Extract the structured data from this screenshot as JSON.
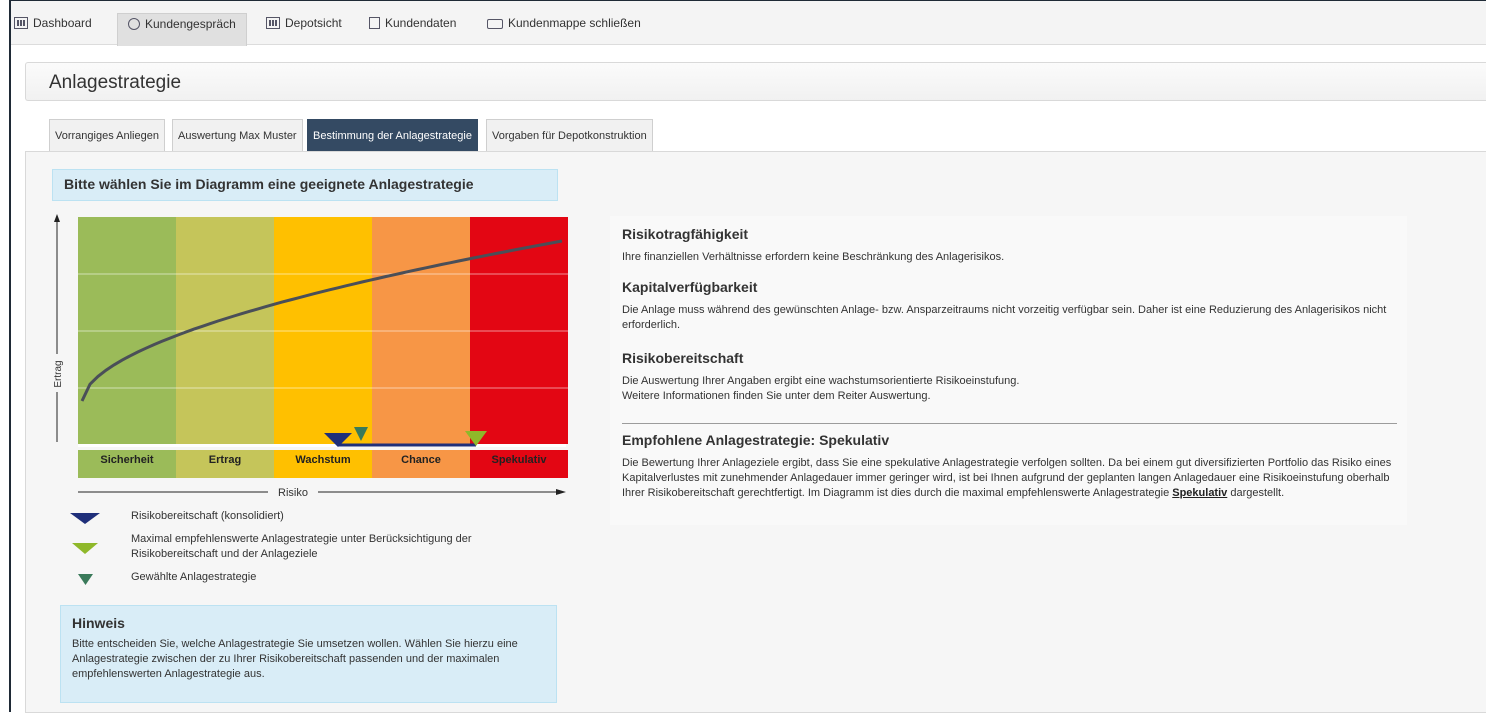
{
  "nav": {
    "items": [
      {
        "label": "Dashboard",
        "icon": "dashboard-icon"
      },
      {
        "label": "Kundengespräch",
        "icon": "people-icon",
        "active": true
      },
      {
        "label": "Depotsicht",
        "icon": "depot-icon"
      },
      {
        "label": "Kundendaten",
        "icon": "document-icon"
      },
      {
        "label": "Kundenmappe schließen",
        "icon": "folder-icon"
      }
    ]
  },
  "page": {
    "title": "Anlagestrategie"
  },
  "tabs": [
    {
      "label": "Vorrangiges Anliegen"
    },
    {
      "label": "Auswertung Max Muster"
    },
    {
      "label": "Bestimmung der Anlagestrategie",
      "active": true
    },
    {
      "label": "Vorgaben für Depotkonstruktion"
    }
  ],
  "instruction": "Bitte wählen Sie im Diagramm eine geeignete Anlagestrategie",
  "chart_data": {
    "type": "area",
    "ylabel": "Ertrag",
    "xlabel": "Risiko",
    "categories": [
      "Sicherheit",
      "Ertrag",
      "Wachstum",
      "Chance",
      "Spekulativ"
    ],
    "category_colors": [
      "#9bbb59",
      "#c5c55a",
      "#ffc000",
      "#f79646",
      "#e30613"
    ],
    "curve_shape": "logarithmic-increasing",
    "markers": {
      "risikobereitschaft": "Wachstum",
      "gewaehlt": "Wachstum",
      "max_empfohlen": "Spekulativ"
    },
    "grid": true
  },
  "legend": [
    {
      "icon": "navy-triangle-icon",
      "color": "#1f2f7a",
      "text": "Risikobereitschaft (konsolidiert)"
    },
    {
      "icon": "green-triangle-icon",
      "color": "#8fb82a",
      "text": "Maximal empfehlenswerte Anlagestrategie unter Berücksichtigung der Risikobereitschaft und der Anlageziele"
    },
    {
      "icon": "teal-triangle-icon",
      "color": "#3a7a5a",
      "text": "Gewählte Anlagestrategie"
    }
  ],
  "hint": {
    "title": "Hinweis",
    "text": "Bitte entscheiden Sie, welche Anlagestrategie Sie umsetzen wollen. Wählen Sie hierzu eine Anlagestrategie zwischen der zu Ihrer Risikobereitschaft passenden und der maximalen empfehlenswerten Anlagestrategie aus."
  },
  "info": {
    "s1_title": "Risikotragfähigkeit",
    "s1_text": "Ihre finanziellen Verhältnisse erfordern keine Beschränkung des Anlagerisikos.",
    "s2_title": "Kapitalverfügbarkeit",
    "s2_text": "Die Anlage muss während des gewünschten Anlage- bzw. Ansparzeitraums nicht vorzeitig verfügbar sein. Daher ist eine Reduzierung des Anlagerisikos nicht erforderlich.",
    "s3_title": "Risikobereitschaft",
    "s3_text1": "Die Auswertung Ihrer Angaben ergibt eine wachstumsorientierte Risikoeinstufung.",
    "s3_text2": "Weitere Informationen finden Sie unter dem Reiter Auswertung.",
    "s4_title": "Empfohlene Anlagestrategie: Spekulativ",
    "s4_text": "Die Bewertung Ihrer Anlageziele ergibt, dass Sie eine spekulative Anlagestrategie verfolgen sollten. Da bei einem gut diversifizierten Portfolio das Risiko eines Kapitalverlustes mit zunehmender Anlagedauer immer geringer wird, ist bei Ihnen aufgrund der geplanten langen Anlagedauer eine Risikoeinstufung oberhalb Ihrer Risikobereitschaft gerechtfertigt. Im Diagramm ist dies durch die maximal empfehlenswerte Anlagestrategie",
    "s4_link": "Spekulativ",
    "s4_tail": "dargestellt."
  }
}
